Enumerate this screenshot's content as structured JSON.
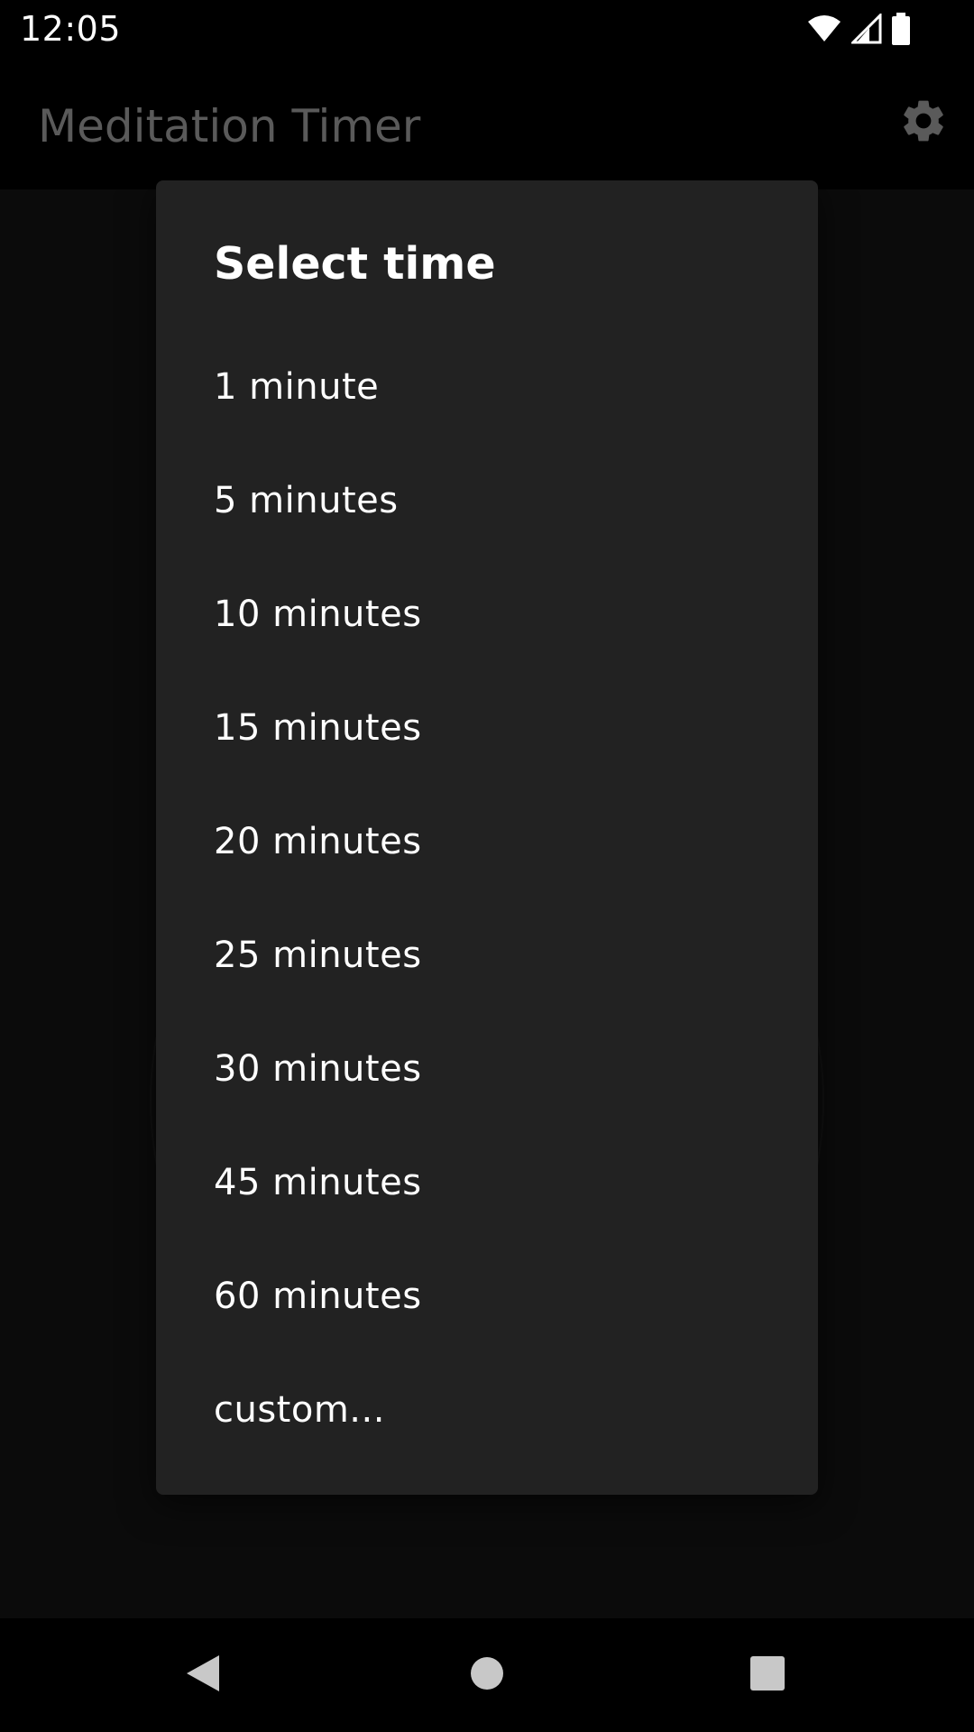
{
  "status_bar": {
    "time": "12:05",
    "icons": [
      "wifi-icon",
      "cell-signal-icon",
      "battery-icon"
    ]
  },
  "app_bar": {
    "title": "Meditation Timer",
    "settings_icon": "gear-icon"
  },
  "dialog": {
    "title": "Select time",
    "options": [
      "1 minute",
      "5 minutes",
      "10 minutes",
      "15 minutes",
      "20 minutes",
      "25 minutes",
      "30 minutes",
      "45 minutes",
      "60 minutes",
      "custom..."
    ]
  },
  "nav_bar": {
    "buttons": [
      "back-icon",
      "home-icon",
      "recents-icon"
    ]
  },
  "colors": {
    "background": "#0a0a0a",
    "dialog_background": "#222222",
    "title_dim": "#5a5a5a",
    "text": "#ffffff"
  }
}
